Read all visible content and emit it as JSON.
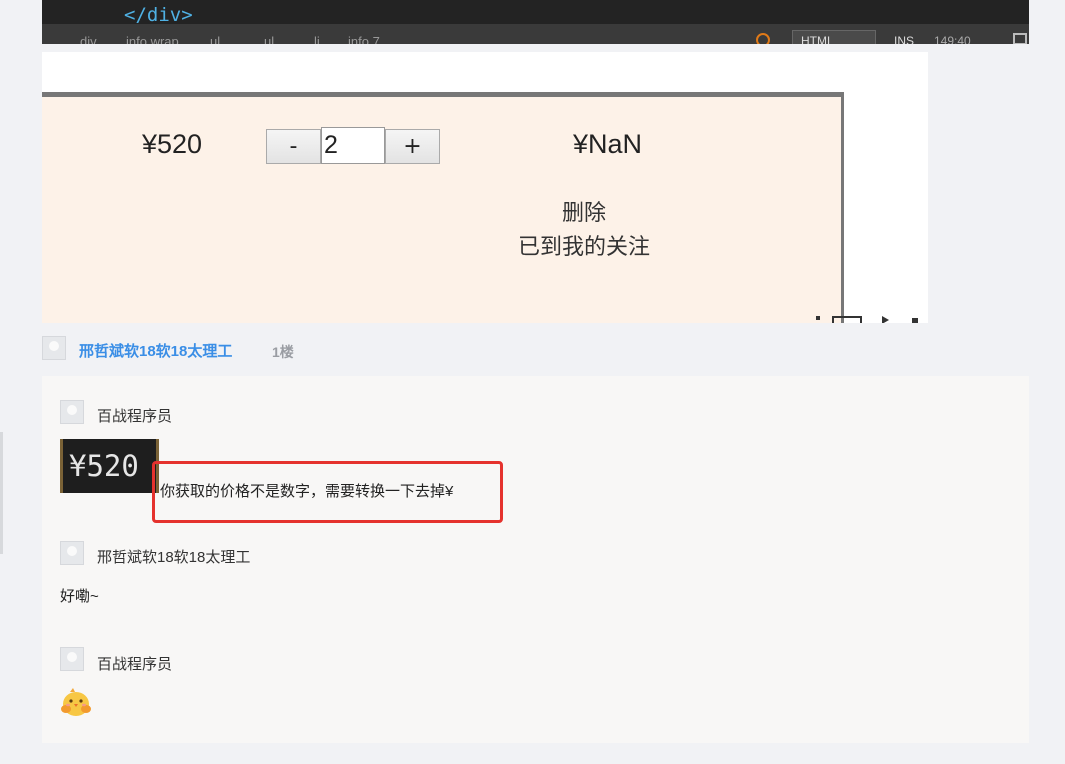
{
  "editor": {
    "code_line": "</div>",
    "breadcrumbs": [
      "div",
      "info wrap",
      "ul",
      "ul",
      "li",
      "info 7"
    ],
    "language": "HTML",
    "mode": "INS",
    "cursor": "149:40"
  },
  "preview": {
    "price": "¥520",
    "minus_label": "-",
    "quantity": "2",
    "plus_label": "+",
    "subtotal": "¥NaN",
    "delete_label": "删除",
    "follow_label": "已到我的关注"
  },
  "floor": {
    "user": "邢哲斌软18软18太理工",
    "number": "1楼"
  },
  "replies": [
    {
      "user": "百战程序员",
      "image_text": "¥520",
      "text": "你获取的价格不是数字，需要转换一下去掉¥"
    },
    {
      "user": "邢哲斌软18软18太理工",
      "text": "好嘞~"
    },
    {
      "user": "百战程序员",
      "emoji": "chick-hug-emoji"
    }
  ],
  "colors": {
    "link_blue": "#3a8ee6",
    "highlight_red": "#e5322d",
    "editor_bg": "#232323",
    "cart_bg": "#fdf2e8"
  }
}
